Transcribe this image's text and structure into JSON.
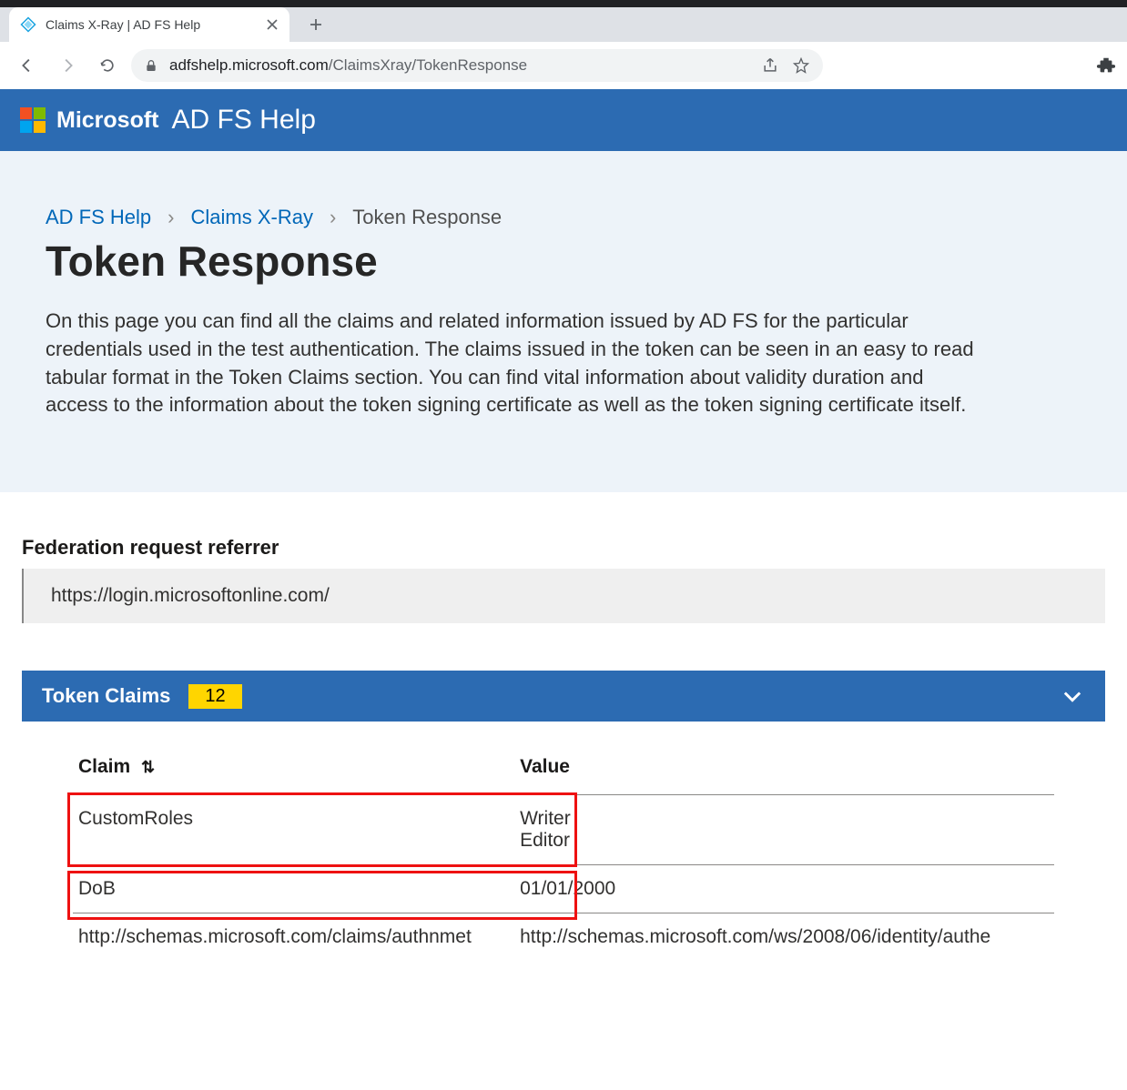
{
  "browser": {
    "tab_title": "Claims X-Ray | AD FS Help",
    "url_host": "adfshelp.microsoft.com",
    "url_path": "/ClaimsXray/TokenResponse"
  },
  "header": {
    "brand": "Microsoft",
    "app": "AD FS Help"
  },
  "breadcrumb": {
    "items": [
      "AD FS Help",
      "Claims X-Ray"
    ],
    "current": "Token Response"
  },
  "page": {
    "title": "Token Response",
    "intro": "On this page you can find all the claims and related information issued by AD FS for the particular credentials used in the test authentication. The claims issued in the token can be seen in an easy to read tabular format in the Token Claims section. You can find vital information about validity duration and access to the information about the token signing certificate as well as the token signing certificate itself."
  },
  "referrer": {
    "label": "Federation request referrer",
    "value": "https://login.microsoftonline.com/"
  },
  "token_claims": {
    "title": "Token Claims",
    "count": "12",
    "columns": {
      "claim": "Claim",
      "value": "Value"
    },
    "rows": [
      {
        "claim": "CustomRoles",
        "value_lines": [
          "Writer",
          "Editor"
        ]
      },
      {
        "claim": "DoB",
        "value_lines": [
          "01/01/2000"
        ]
      },
      {
        "claim": "http://schemas.microsoft.com/claims/authnmet",
        "value_lines": [
          "http://schemas.microsoft.com/ws/2008/06/identity/authe"
        ]
      }
    ]
  }
}
